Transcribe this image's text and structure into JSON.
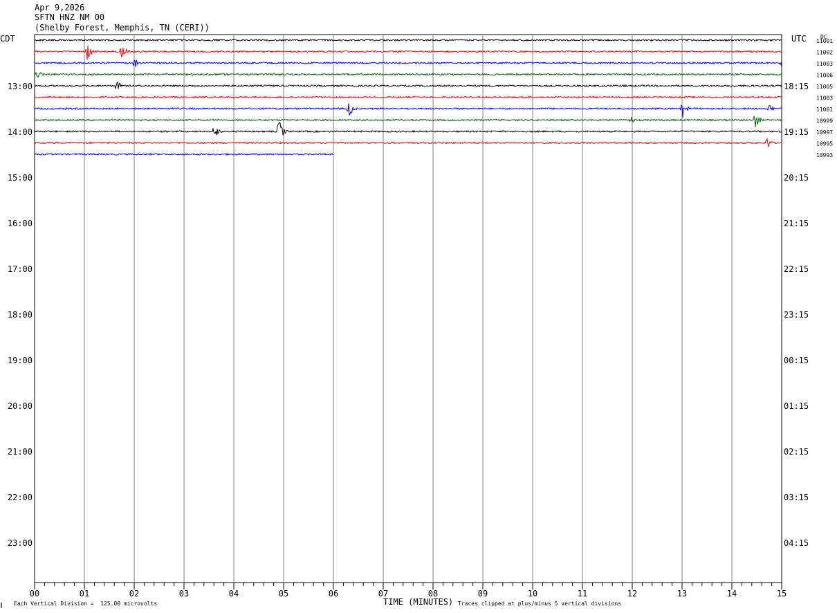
{
  "header": {
    "date": "Apr 9,2026",
    "station": "SFTN HNZ NM 00",
    "location": "(Shelby Forest, Memphis, TN (CERI))"
  },
  "left_tz": "CDT",
  "right_tz": "UTC",
  "dc_header": "DC",
  "footer": {
    "scale": "Each Vertical Division =  125.00 microvolts",
    "axis_title": "TIME (MINUTES)",
    "clip_note": "Traces clipped at plus/minus 5 vertical divisions",
    "mark": "∥"
  },
  "chart_data": {
    "type": "line",
    "title": "",
    "xlabel": "TIME (MINUTES)",
    "xlim": [
      0,
      15
    ],
    "x_ticks": [
      "00",
      "01",
      "02",
      "03",
      "04",
      "05",
      "06",
      "07",
      "08",
      "09",
      "10",
      "11",
      "12",
      "13",
      "14",
      "15"
    ],
    "hour_labels_left": [
      "13:00",
      "14:00",
      "15:00",
      "16:00",
      "17:00",
      "18:00",
      "19:00",
      "20:00",
      "21:00",
      "22:00",
      "23:00"
    ],
    "hour_labels_right": [
      "18:15",
      "19:15",
      "20:15",
      "21:15",
      "22:15",
      "23:15",
      "00:15",
      "01:15",
      "02:15",
      "03:15",
      "04:15"
    ],
    "trace_colors": [
      "#000000",
      "#ff0000",
      "#0000ff",
      "#006400"
    ],
    "grid": true,
    "traces": [
      {
        "dc": "11001",
        "end": 15,
        "events": [
          {
            "t": 1.4,
            "amp": 0.3
          }
        ]
      },
      {
        "dc": "11002",
        "end": 15,
        "events": [
          {
            "t": 1.05,
            "amp": 2.2
          },
          {
            "t": 1.75,
            "amp": 2.6
          }
        ]
      },
      {
        "dc": "11003",
        "end": 15,
        "events": [
          {
            "t": 2.0,
            "amp": 1.6
          },
          {
            "t": 15.0,
            "amp": 1.0
          }
        ]
      },
      {
        "dc": "11006",
        "end": 15,
        "events": [
          {
            "t": 0.05,
            "amp": 1.2
          },
          {
            "t": 3.15,
            "amp": 0.3
          },
          {
            "t": 8.0,
            "amp": 0.3
          }
        ]
      },
      {
        "dc": "11005",
        "end": 15,
        "events": [
          {
            "t": 1.65,
            "amp": 1.3
          },
          {
            "t": 11.8,
            "amp": 0.3
          }
        ]
      },
      {
        "dc": "11003",
        "end": 15,
        "events": []
      },
      {
        "dc": "11001",
        "end": 15,
        "events": [
          {
            "t": 6.3,
            "amp": 2.3
          },
          {
            "t": 8.5,
            "amp": 0.3
          },
          {
            "t": 13.0,
            "amp": 2.2
          },
          {
            "t": 14.75,
            "amp": 1.0
          }
        ]
      },
      {
        "dc": "10999",
        "end": 15,
        "events": [
          {
            "t": 11.95,
            "amp": 1.3
          },
          {
            "t": 14.45,
            "amp": 2.4
          }
        ]
      },
      {
        "dc": "10997",
        "end": 15,
        "events": [
          {
            "t": 3.6,
            "amp": 2.0
          },
          {
            "t": 4.9,
            "amp": 3.0
          }
        ]
      },
      {
        "dc": "10995",
        "end": 15,
        "events": [
          {
            "t": 14.7,
            "amp": 1.7
          }
        ]
      },
      {
        "dc": "10993",
        "end": 6,
        "events": []
      }
    ]
  }
}
